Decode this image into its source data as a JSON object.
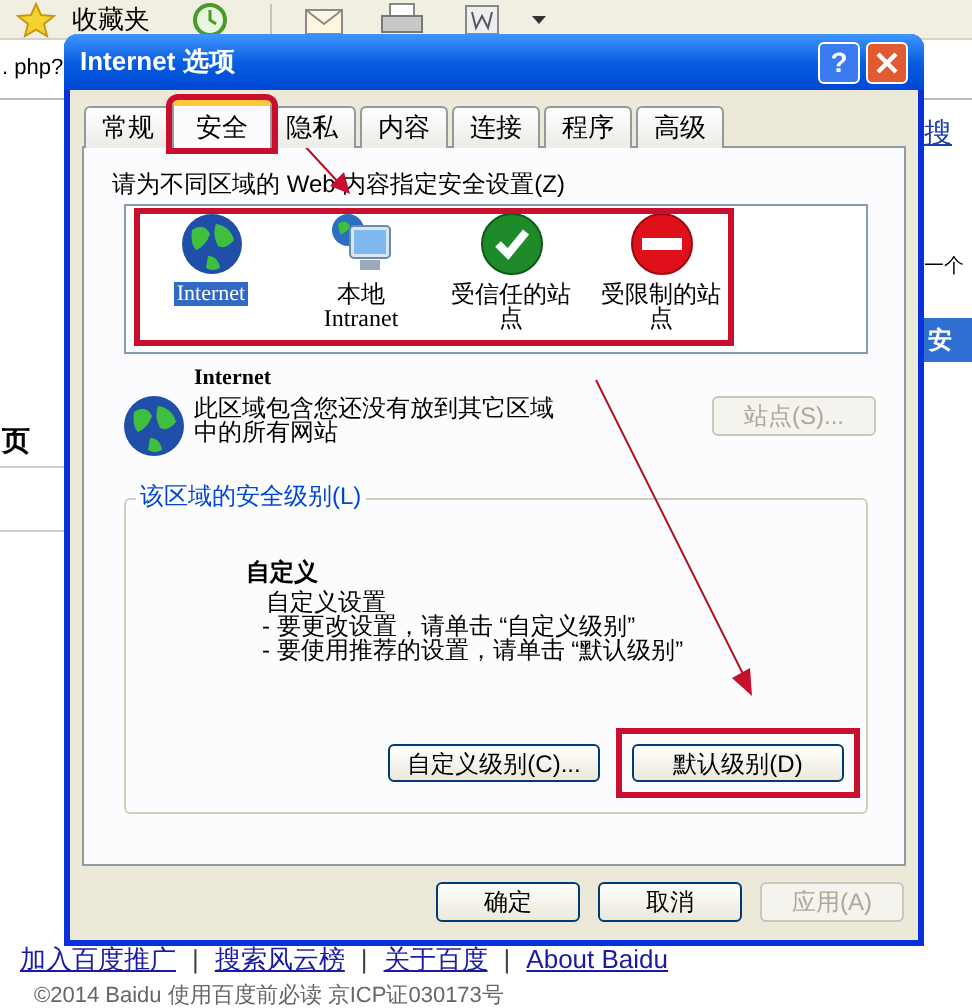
{
  "browser": {
    "toolbar": {
      "favorites_label": "收藏夹"
    },
    "address_fragment": ". php?",
    "left_fragment": "页",
    "right_fragments": [
      {
        "text": "搜",
        "kind": "link"
      },
      {
        "text": "一个",
        "kind": "plain"
      },
      {
        "text": "安",
        "kind": "bar"
      }
    ],
    "footer_links": [
      "加入百度推广",
      "搜索风云榜",
      "关于百度",
      "About Baidu"
    ],
    "footer_separator": "|",
    "copyright": "©2014 Baidu 使用百度前必读 京ICP证030173号"
  },
  "dialog": {
    "title": "Internet 选项",
    "help": "?",
    "tabs": [
      {
        "label": "常规",
        "selected": false,
        "highlighted": false
      },
      {
        "label": "安全",
        "selected": true,
        "highlighted": true
      },
      {
        "label": "隐私",
        "selected": false,
        "highlighted": false
      },
      {
        "label": "内容",
        "selected": false,
        "highlighted": false
      },
      {
        "label": "连接",
        "selected": false,
        "highlighted": false
      },
      {
        "label": "程序",
        "selected": false,
        "highlighted": false
      },
      {
        "label": "高级",
        "selected": false,
        "highlighted": false
      }
    ],
    "zones_prompt": "请为不同区域的 Web 内容指定安全设置(Z)",
    "zones_highlighted": true,
    "zones": [
      {
        "label": "Internet",
        "kind": "globe",
        "selected": true
      },
      {
        "label": "本地\nIntranet",
        "kind": "computer",
        "selected": false
      },
      {
        "label": "受信任的站点",
        "kind": "trusted",
        "selected": false
      },
      {
        "label": "受限制的站点",
        "kind": "restricted",
        "selected": false
      }
    ],
    "zone_name": "Internet",
    "zone_description": "此区域包含您还没有放到其它区域中的所有网站",
    "sites_button": {
      "label": "站点(S)...",
      "disabled": true
    },
    "level_group": {
      "legend": "该区域的安全级别(L)",
      "level_name": "自定义",
      "details": [
        "自定义设置",
        "- 要更改设置，请单击 “自定义级别”",
        "- 要使用推荐的设置，请单击 “默认级别”"
      ],
      "buttons": [
        {
          "label": "自定义级别(C)...",
          "highlighted": false
        },
        {
          "label": "默认级别(D)",
          "highlighted": true
        }
      ]
    },
    "buttons": [
      {
        "label": "确定",
        "disabled": false
      },
      {
        "label": "取消",
        "disabled": false
      },
      {
        "label": "应用(A)",
        "disabled": true
      }
    ]
  }
}
